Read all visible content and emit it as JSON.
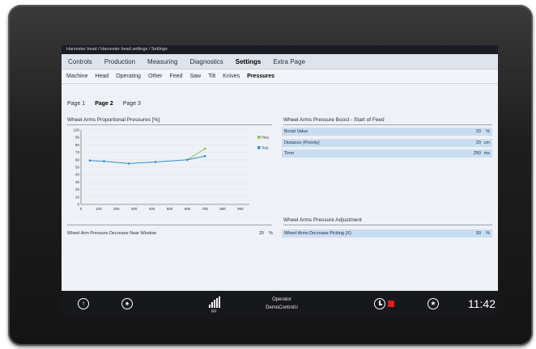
{
  "breadcrumb": "Harvester head / Harvester head settings / Settings",
  "main_tabs": [
    {
      "label": "Controls",
      "active": false
    },
    {
      "label": "Production",
      "active": false
    },
    {
      "label": "Measuring",
      "active": false
    },
    {
      "label": "Diagnostics",
      "active": false
    },
    {
      "label": "Settings",
      "active": true
    },
    {
      "label": "Extra Page",
      "active": false
    }
  ],
  "sub_tabs": [
    {
      "label": "Machine",
      "active": false
    },
    {
      "label": "Head",
      "active": false
    },
    {
      "label": "Operating",
      "active": false
    },
    {
      "label": "Other",
      "active": false
    },
    {
      "label": "Feed",
      "active": false
    },
    {
      "label": "Saw",
      "active": false
    },
    {
      "label": "Tilt",
      "active": false
    },
    {
      "label": "Knives",
      "active": false
    },
    {
      "label": "Pressures",
      "active": true
    }
  ],
  "pages": [
    {
      "label": "Page 1",
      "active": false
    },
    {
      "label": "Page 2",
      "active": true
    },
    {
      "label": "Page 3",
      "active": false
    }
  ],
  "chart_section_title": "Wheel Arms Proportional Pressures [%]",
  "chart_data": {
    "type": "line",
    "title": "Wheel Arms Proportional Pressures [%]",
    "x": [
      0,
      100,
      200,
      300,
      400,
      500,
      600,
      700,
      800,
      900
    ],
    "xlim": [
      0,
      950
    ],
    "ylim": [
      0,
      100
    ],
    "yticks": [
      0,
      10,
      20,
      30,
      40,
      50,
      60,
      70,
      80,
      90,
      100
    ],
    "xticks": [
      0,
      100,
      200,
      300,
      400,
      500,
      600,
      700,
      800,
      900
    ],
    "series": [
      {
        "name": "Pine",
        "color": "#7fc24a",
        "x": [
          600,
          700
        ],
        "values": [
          60,
          75
        ]
      },
      {
        "name": "Test",
        "color": "#2c8fd6",
        "x": [
          50,
          130,
          270,
          420,
          600,
          700
        ],
        "values": [
          59,
          58,
          55,
          57,
          60,
          65
        ]
      }
    ]
  },
  "boost": {
    "title": "Wheel Arms Pressure Boost - Start of Feed",
    "rows": [
      {
        "label": "Boost Value",
        "value": "20",
        "unit": "%"
      },
      {
        "label": "Distance (Priority)",
        "value": "20",
        "unit": "cm"
      },
      {
        "label": "Time",
        "value": "250",
        "unit": "ms"
      }
    ]
  },
  "decrease": {
    "label": "Wheel Arm Pressure Decrease Near Window",
    "value": "20",
    "unit": "%"
  },
  "adjustment": {
    "title": "Wheel Arms Pressure Adjustment",
    "rows": [
      {
        "label": "Wheel Arms Decrease Picking (X)",
        "value": "50",
        "unit": "%"
      }
    ]
  },
  "bottom": {
    "signal_label": "RF",
    "operator_label": "Operator",
    "operator_name": "DemoControlU",
    "time": "11:42",
    "colors": {
      "alarm": "#e21d1d"
    }
  }
}
